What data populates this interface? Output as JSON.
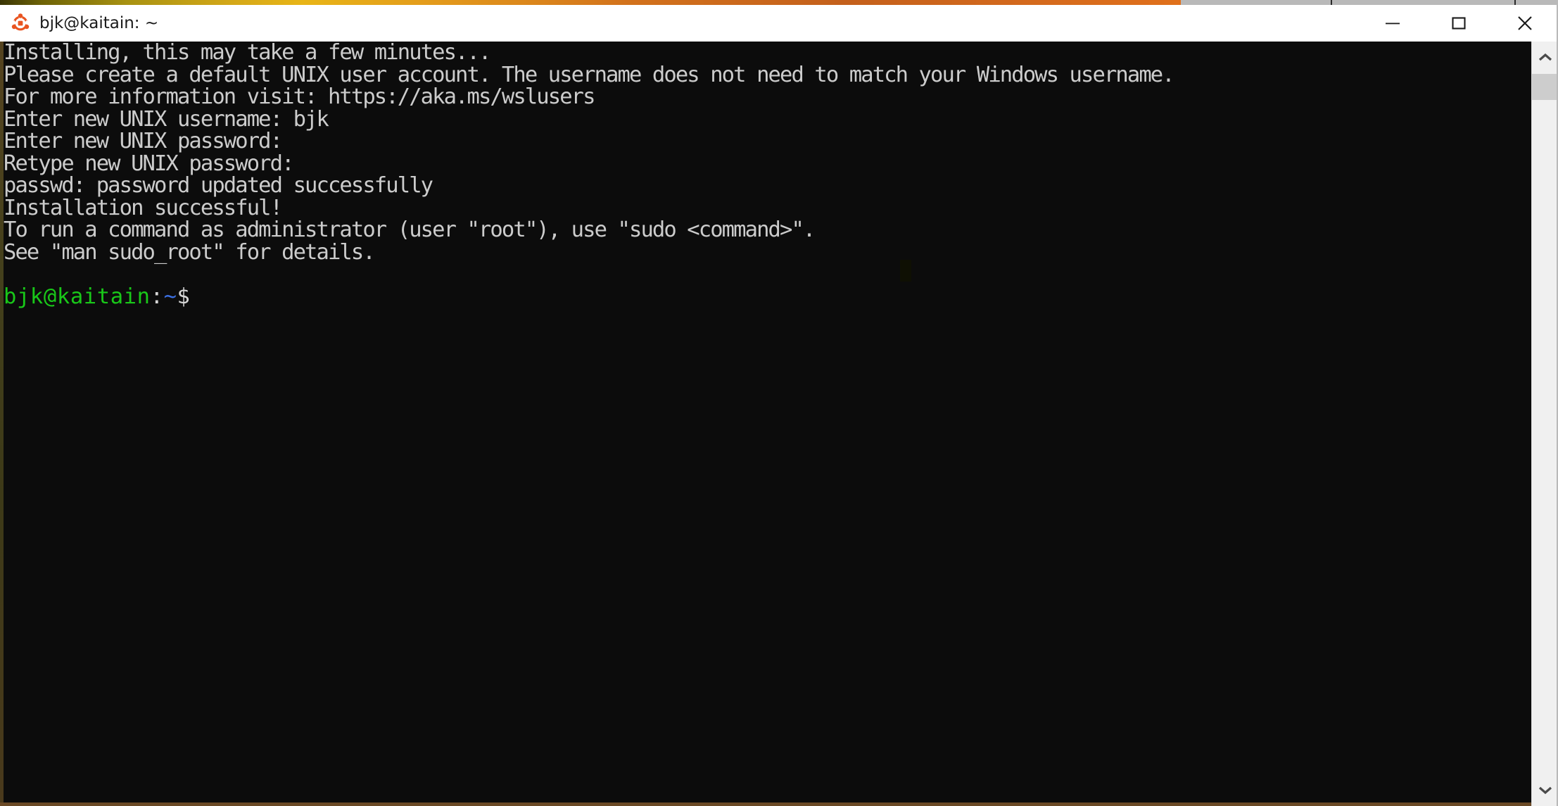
{
  "window": {
    "title": "bjk@kaitain: ~",
    "app_icon": "ubuntu-logo-icon",
    "controls": {
      "minimize": "minimize-button",
      "maximize": "maximize-button",
      "close": "close-button"
    }
  },
  "colors": {
    "ubuntu_orange": "#E95420",
    "terminal_bg": "#0C0C0C",
    "terminal_fg": "#CCCCCC",
    "prompt_user_host": "#19C819",
    "prompt_path": "#3B6FE0",
    "titlebar_bg": "#FFFFFF",
    "scrollbar_track": "#F0F0F0",
    "scrollbar_thumb": "#CDCDCD",
    "accent_strip_end": "#E0701B"
  },
  "terminal": {
    "lines": [
      "Installing, this may take a few minutes...",
      "Please create a default UNIX user account. The username does not need to match your Windows username.",
      "For more information visit: https://aka.ms/wslusers",
      "Enter new UNIX username: bjk",
      "Enter new UNIX password:",
      "Retype new UNIX password:",
      "passwd: password updated successfully",
      "Installation successful!",
      "To run a command as administrator (user \"root\"), use \"sudo <command>\".",
      "See \"man sudo_root\" for details.",
      ""
    ],
    "prompt": {
      "user_host": "bjk@kaitain",
      "colon": ":",
      "path": "~",
      "sigil": "$",
      "input": ""
    }
  },
  "scrollbar": {
    "up_arrow": "chevron-up-icon",
    "down_arrow": "chevron-down-icon",
    "thumb": "scrollbar-thumb"
  }
}
